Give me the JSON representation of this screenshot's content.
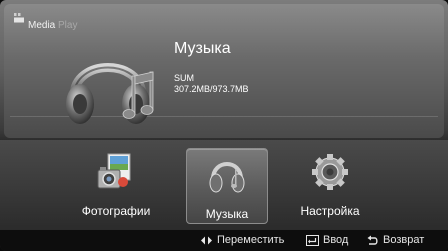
{
  "header": {
    "logo_word1": "Media",
    "logo_word2": "Play"
  },
  "current": {
    "title": "Музыка",
    "device": "SUM",
    "storage": "307.2MB/973.7MB"
  },
  "menu": {
    "items": [
      {
        "label": "Фотографии",
        "icon": "photos-icon",
        "selected": false
      },
      {
        "label": "Музыка",
        "icon": "headphones-icon",
        "selected": true
      },
      {
        "label": "Настройка",
        "icon": "gear-icon",
        "selected": false
      }
    ]
  },
  "footer": {
    "move": "Переместить",
    "enter": "Ввод",
    "back": "Возврат"
  }
}
